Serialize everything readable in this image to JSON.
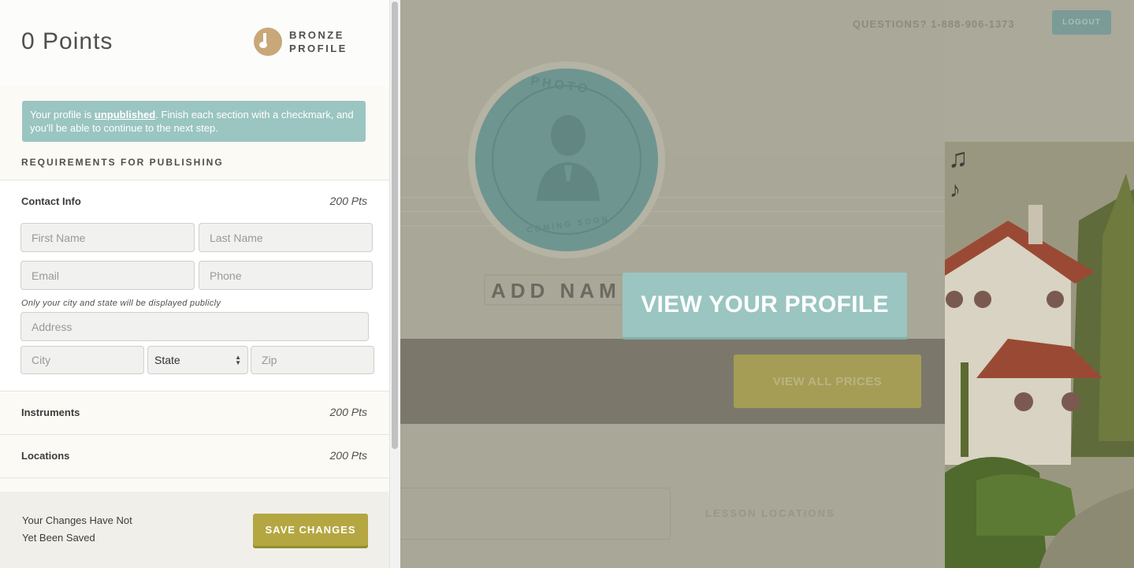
{
  "header": {
    "points": "0 Points",
    "badge_line1": "BRONZE",
    "badge_line2": "PROFILE",
    "badge_icon": "music-note-icon"
  },
  "notice": {
    "prefix": "Your profile is ",
    "status": "unpublished",
    "suffix": ". Finish each section with a checkmark, and you'll be able to continue to the next step."
  },
  "requirements_title": "REQUIREMENTS FOR PUBLISHING",
  "sections": {
    "contact": {
      "label": "Contact Info",
      "points": "200 Pts"
    },
    "instruments": {
      "label": "Instruments",
      "points": "200 Pts"
    },
    "locations": {
      "label": "Locations",
      "points": "200 Pts"
    }
  },
  "form": {
    "first_name": {
      "placeholder": "First Name",
      "value": ""
    },
    "last_name": {
      "placeholder": "Last Name",
      "value": ""
    },
    "email": {
      "placeholder": "Email",
      "value": ""
    },
    "phone": {
      "placeholder": "Phone",
      "value": ""
    },
    "privacy_hint": "Only your city and state will be displayed publicly",
    "address": {
      "placeholder": "Address",
      "value": ""
    },
    "city": {
      "placeholder": "City",
      "value": ""
    },
    "state": {
      "selected": "State"
    },
    "zip": {
      "placeholder": "Zip",
      "value": ""
    }
  },
  "footer": {
    "status_line1": "Your Changes Have Not",
    "status_line2": "Yet Been Saved",
    "save_label": "SAVE CHANGES"
  },
  "background": {
    "questions": "QUESTIONS? 1-888-906-1373",
    "logout_label": "LOGOUT",
    "photo_top": "PHOTO",
    "photo_bottom": "COMING SOON",
    "add_name": "ADD NAM",
    "view_profile_label": "VIEW YOUR PROFILE",
    "view_prices_label": "VIEW ALL PRICES",
    "lesson_locations": "LESSON LOCATIONS"
  },
  "colors": {
    "accent_teal": "#9ac5c1",
    "save_gold": "#b4a741",
    "badge_bronze": "#c8a878"
  }
}
